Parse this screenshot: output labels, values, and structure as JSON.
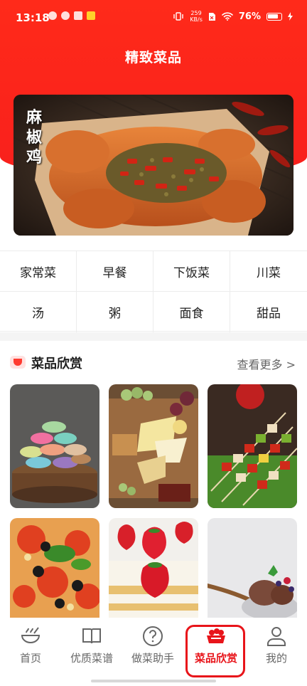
{
  "status_bar": {
    "time": "13:18",
    "net_speed_value": "259",
    "net_speed_unit": "KB/s",
    "battery_percent": "76%"
  },
  "header": {
    "title": "精致菜品"
  },
  "banner": {
    "caption": "麻椒鸡"
  },
  "categories": [
    "家常菜",
    "早餐",
    "下饭菜",
    "川菜",
    "汤",
    "粥",
    "面食",
    "甜品"
  ],
  "section": {
    "title": "菜品欣赏",
    "more": "查看更多 >"
  },
  "photos": [
    "macarons",
    "cheese-platter",
    "kebab-skewers",
    "pizza",
    "strawberry-cake",
    "chocolate-ice-cream"
  ],
  "tabs": [
    {
      "label": "首页",
      "icon": "bowl-icon"
    },
    {
      "label": "优质菜谱",
      "icon": "recipe-book-icon"
    },
    {
      "label": "做菜助手",
      "icon": "help-icon"
    },
    {
      "label": "菜品欣赏",
      "icon": "dish-basket-icon"
    },
    {
      "label": "我的",
      "icon": "user-icon"
    }
  ],
  "active_tab": "菜品欣赏",
  "colors": {
    "brand_red": "#f8201c",
    "active_tab": "#e8141a"
  }
}
